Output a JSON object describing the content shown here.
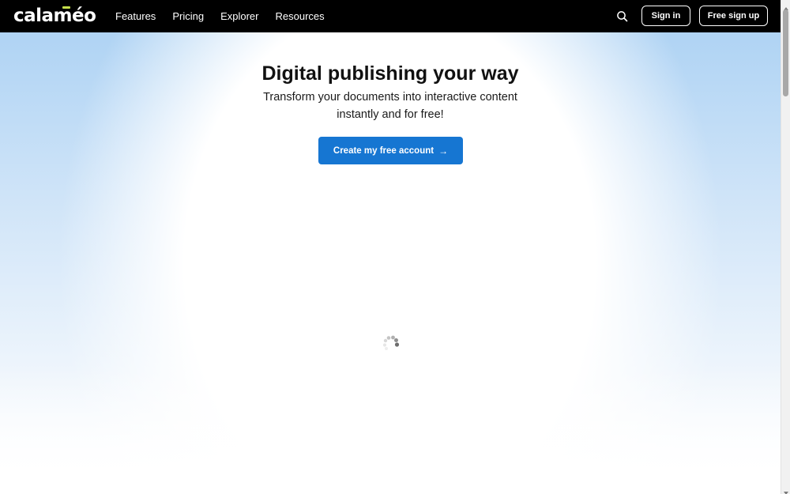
{
  "header": {
    "logo_text": "calaméo",
    "nav": [
      {
        "label": "Features"
      },
      {
        "label": "Pricing"
      },
      {
        "label": "Explorer"
      },
      {
        "label": "Resources"
      }
    ],
    "search_icon": "search-icon",
    "sign_in_label": "Sign in",
    "sign_up_label": "Free sign up"
  },
  "hero": {
    "title": "Digital publishing your way",
    "subtitle_line1": "Transform your documents into interactive content",
    "subtitle_line2": "instantly and for free!",
    "cta_label": "Create my free account",
    "cta_icon": "arrow-right-icon"
  },
  "loading": {
    "icon": "loading-spinner-icon"
  },
  "colors": {
    "header_bg": "#000000",
    "cta_bg": "#1676d2",
    "logo_accent": "#c6e04b",
    "background_tint": "#a9d0f3"
  }
}
